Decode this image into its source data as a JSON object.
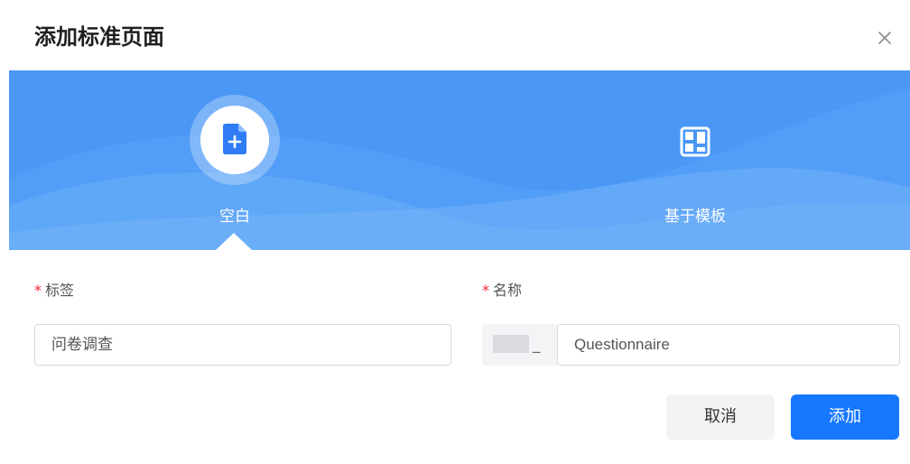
{
  "dialog": {
    "title": "添加标准页面",
    "close_icon": "close-icon"
  },
  "banner": {
    "background_color": "#4a97f5",
    "options": [
      {
        "label": "空白",
        "icon": "blank-page-add-icon",
        "selected": true
      },
      {
        "label": "基于模板",
        "icon": "template-layout-icon",
        "selected": false
      }
    ]
  },
  "form": {
    "tag": {
      "required_mark": "*",
      "label": "标签",
      "value": "问卷调查"
    },
    "name": {
      "required_mark": "*",
      "label": "名称",
      "prefix_separator": "_",
      "value": "Questionnaire"
    }
  },
  "footer": {
    "cancel_label": "取消",
    "add_label": "添加",
    "primary_color": "#1677ff"
  }
}
